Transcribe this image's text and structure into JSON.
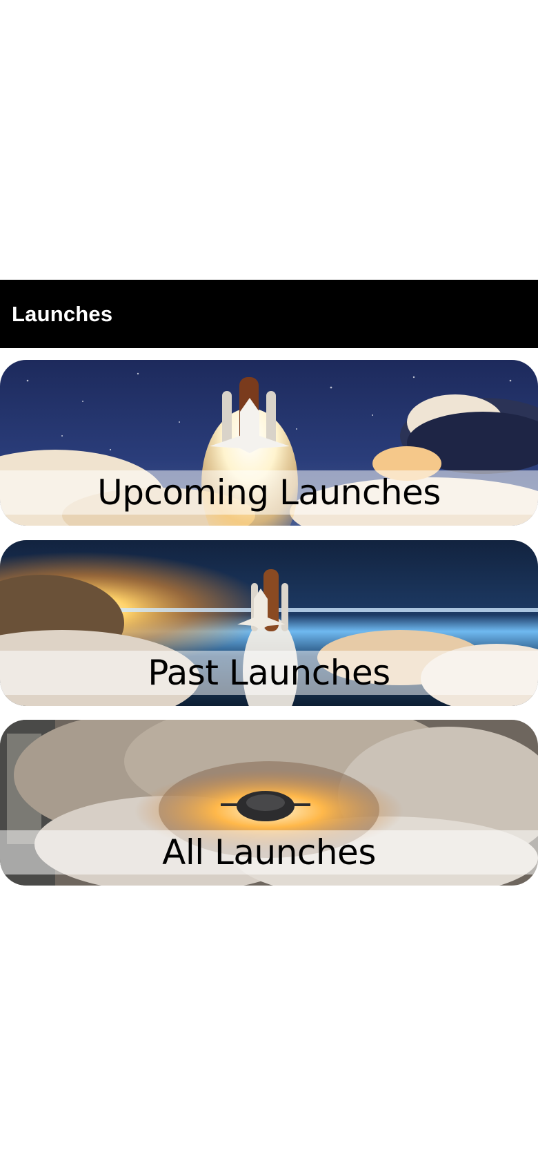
{
  "nav": {
    "title": "Launches"
  },
  "cards": [
    {
      "label": "Upcoming Launches",
      "image": "space-shuttle-liftoff-night-clouds"
    },
    {
      "label": "Past Launches",
      "image": "space-shuttle-earth-horizon-sunrise"
    },
    {
      "label": "All Launches",
      "image": "rocket-launch-overhead-smoke"
    }
  ],
  "colors": {
    "nav_background": "#000000",
    "nav_text": "#ffffff",
    "page_background": "#ffffff",
    "label_text": "#000000"
  }
}
